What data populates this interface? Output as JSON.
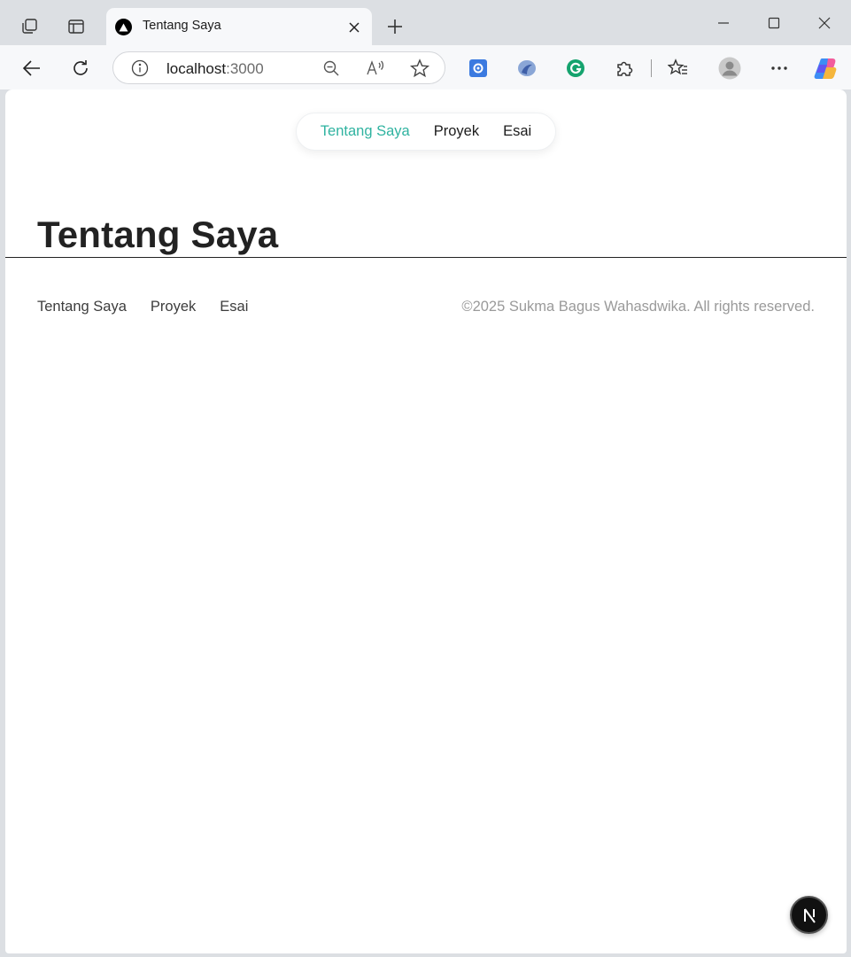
{
  "browser": {
    "tab": {
      "title": "Tentang Saya"
    },
    "address": {
      "host": "localhost",
      "port": ":3000"
    }
  },
  "site": {
    "nav": [
      {
        "label": "Tentang Saya",
        "active": true
      },
      {
        "label": "Proyek",
        "active": false
      },
      {
        "label": "Esai",
        "active": false
      }
    ],
    "page_title": "Tentang Saya",
    "footer": {
      "links": [
        "Tentang Saya",
        "Proyek",
        "Esai"
      ],
      "copyright": "©2025 Sukma Bagus Wahasdwika. All rights reserved."
    },
    "dev_badge_icon": "nextjs-n-icon"
  },
  "colors": {
    "accent": "#2fb3a0",
    "title": "#222222",
    "muted": "#9a9a9a",
    "chrome_bg": "#dcdfe3"
  }
}
